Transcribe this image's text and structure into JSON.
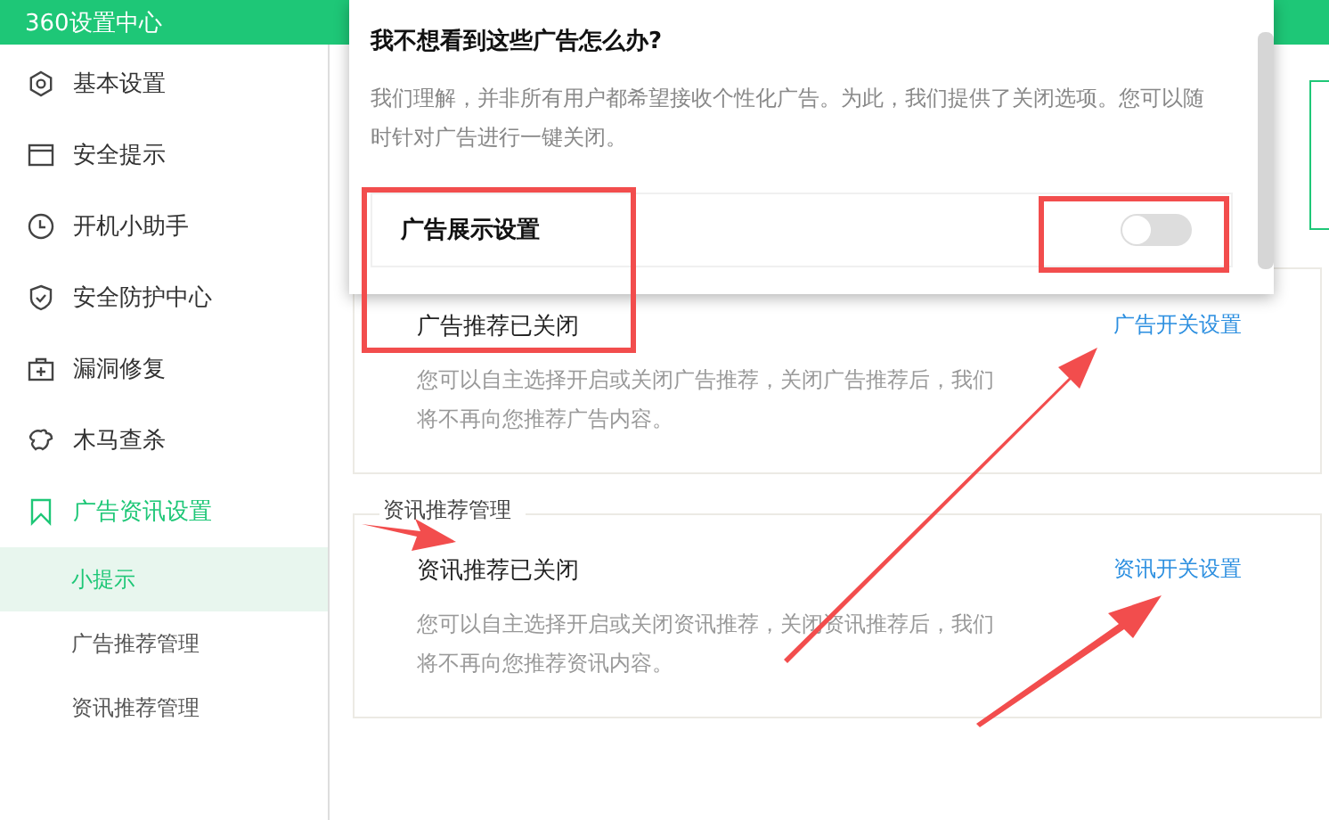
{
  "window": {
    "title": "360设置中心"
  },
  "sidebar": {
    "items": [
      {
        "label": "基本设置",
        "selected": false
      },
      {
        "label": "安全提示",
        "selected": false
      },
      {
        "label": "开机小助手",
        "selected": false
      },
      {
        "label": "安全防护中心",
        "selected": false
      },
      {
        "label": "漏洞修复",
        "selected": false
      },
      {
        "label": "木马查杀",
        "selected": false
      },
      {
        "label": "广告资讯设置",
        "selected": true,
        "children": [
          {
            "label": "小提示",
            "selected": true
          },
          {
            "label": "广告推荐管理",
            "selected": false
          },
          {
            "label": "资讯推荐管理",
            "selected": false
          }
        ]
      }
    ]
  },
  "sections": [
    {
      "title": "广告推荐已关闭",
      "description": "您可以自主选择开启或关闭广告推荐，关闭广告推荐后，我们将不再向您推荐广告内容。",
      "link": "广告开关设置"
    },
    {
      "legend": "资讯推荐管理",
      "title": "资讯推荐已关闭",
      "description": "您可以自主选择开启或关闭资讯推荐，关闭资讯推荐后，我们将不再向您推荐资讯内容。",
      "link": "资讯开关设置"
    }
  ],
  "popup": {
    "title": "我不想看到这些广告怎么办?",
    "description": "我们理解，并非所有用户都希望接收个性化广告。为此，我们提供了关闭选项。您可以随时针对广告进行一键关闭。",
    "setting": {
      "label": "广告展示设置",
      "on": false
    }
  }
}
